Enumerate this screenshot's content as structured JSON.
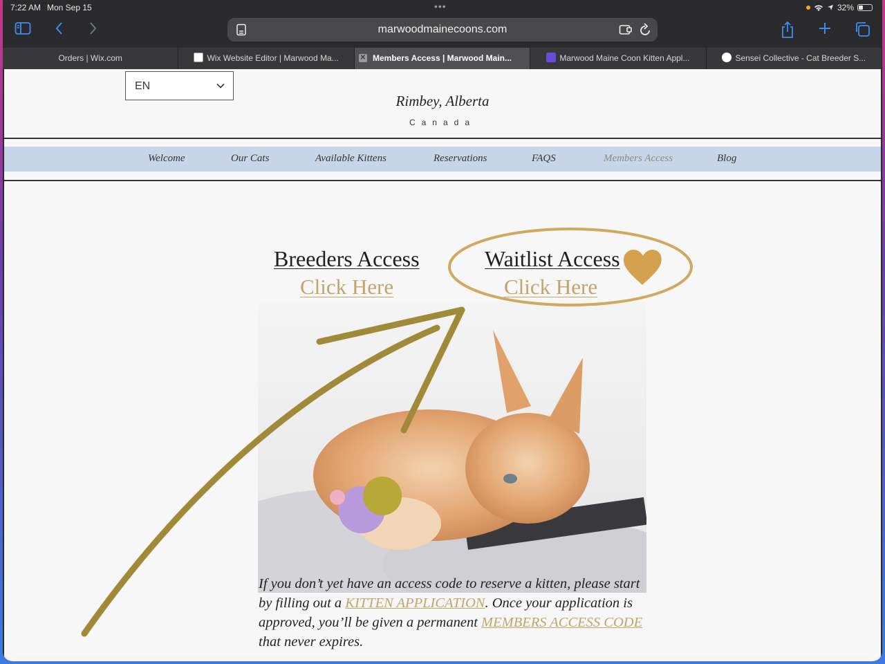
{
  "status": {
    "time": "7:22 AM",
    "date": "Mon Sep 15",
    "dots": "•••",
    "battery": "32%"
  },
  "browser": {
    "url": "marwoodmainecoons.com",
    "tabs": [
      {
        "label": "Orders | Wix.com"
      },
      {
        "label": "Wix Website Editor | Marwood Ma..."
      },
      {
        "label": "Members Access | Marwood Main..."
      },
      {
        "label": "Marwood Maine Coon Kitten Appl..."
      },
      {
        "label": "Sensei Collective - Cat Breeder S..."
      }
    ]
  },
  "site": {
    "language": "EN",
    "location": "Rimbey, Alberta",
    "country": "Canada",
    "nav": [
      "Welcome",
      "Our Cats",
      "Available Kittens",
      "Reservations",
      "FAQS",
      "Members Access",
      "Blog"
    ]
  },
  "access": {
    "breeders_title": "Breeders Access",
    "breeders_link": "Click Here",
    "waitlist_title": "Waitlist Access",
    "waitlist_link": "Click Here"
  },
  "paragraph": {
    "part1": "If you don’t yet have an access code to reserve a kitten, please start by filling out a ",
    "link1": "KITTEN APPLICATION",
    "part2": ". Once your application is approved, you’ll be given a permanent ",
    "link2": "MEMBERS ACCESS CODE",
    "part3": " that never expires."
  },
  "colors": {
    "accent_gold": "#c2a468",
    "annotation": "#a08a3a",
    "nav_bg": "#c6d6e8",
    "url_text": "#f2f2f2",
    "ios_blue": "#3d8ef5"
  }
}
